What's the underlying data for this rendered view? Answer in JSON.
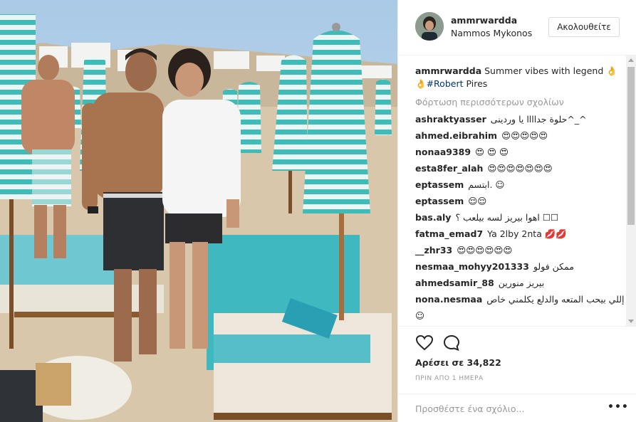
{
  "post": {
    "username": "ammrwardda",
    "location": "Nammos Mykonos",
    "follow_label": "Ακολουθείτε",
    "caption_user": "ammrwardda",
    "caption_text": "Summer vibes with legend 👌",
    "caption_text2": "👌",
    "caption_tag": "#Robert",
    "caption_rest": " Pires",
    "load_more": "Φόρτωση περισσότερων σχολίων"
  },
  "comments": [
    {
      "user": "ashraktyasser",
      "text": "حلوة جداااا يا وردينى^_^"
    },
    {
      "user": "ahmed.eibrahim",
      "text": "😍😍😍😍😍"
    },
    {
      "user": "nonaa9389",
      "text": "😍 😍 😍"
    },
    {
      "user": "esta8fer_alah",
      "text": "😍😍😍😍😍😍😍"
    },
    {
      "user": "eptassem",
      "text": "ابتسم. ☺"
    },
    {
      "user": "eptassem",
      "text": "😌😌"
    },
    {
      "user": "bas.aly",
      "text": "اهوا بيريز لسه بيلعب ؟ ☐☐"
    },
    {
      "user": "fatma_emad7",
      "text": "Ya 2lby 2nta 💋💋"
    },
    {
      "user": "__zhr33",
      "text": "😍😍😍😍😍😍"
    },
    {
      "user": "nesmaa_mohyy201333",
      "text": "ممكن فولو"
    },
    {
      "user": "ahmedsamir_88",
      "text": "بيريز منورين"
    },
    {
      "user": "nona.nesmaa",
      "text": "إللي بيحب المتعه والدلع يكلمني خاص"
    },
    {
      "user": "",
      "text": "☺"
    }
  ],
  "actions": {
    "likes": "Αρέσει σε 34,822",
    "time": "ΠΡΙΝ ΑΠΟ 1 ΗΜΕΡΑ",
    "comment_placeholder": "Προσθέστε ένα σχόλιο...",
    "more": "•••"
  },
  "icons": {
    "heart": "heart-icon",
    "comment": "comment-bubble-icon",
    "more": "more-options-icon"
  },
  "colors": {
    "accent_teal": "#3dbfbf",
    "link": "#003569",
    "muted": "#999999"
  }
}
